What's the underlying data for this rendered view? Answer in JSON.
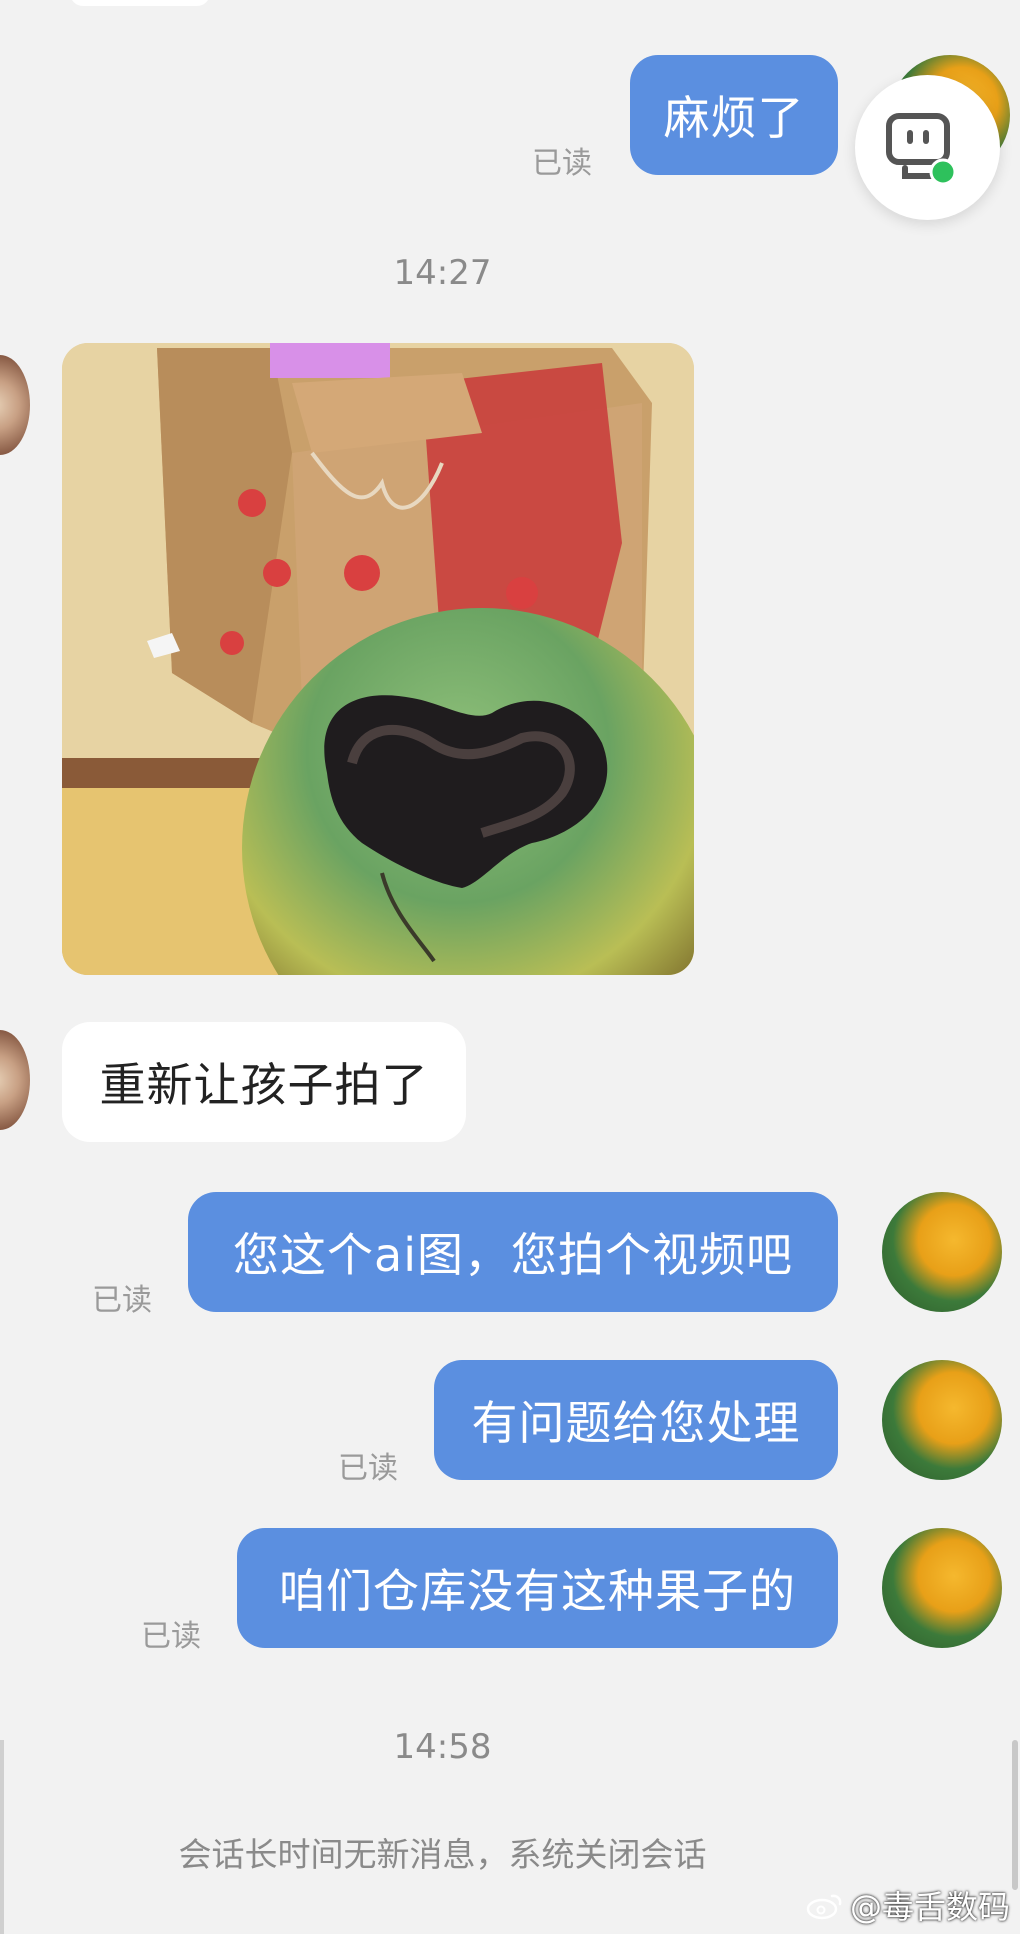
{
  "messages": {
    "m1": {
      "text": "麻烦了",
      "read": "已读"
    },
    "time1": "14:27",
    "m2": {
      "text": "重新让孩子拍了"
    },
    "m3": {
      "text": "您这个ai图，您拍个视频吧",
      "read": "已读"
    },
    "m4": {
      "text": "有问题给您处理",
      "read": "已读"
    },
    "m5": {
      "text": "咱们仓库没有这种果子的",
      "read": "已读"
    },
    "time2": "14:58",
    "system": "会话长时间无新消息，系统关闭会话"
  },
  "watermark": {
    "text": "@毒舌数码"
  },
  "colors": {
    "background": "#f2f2f2",
    "outgoing_bubble": "#5b8fe0",
    "incoming_bubble": "#ffffff",
    "online_dot": "#2ec15c"
  },
  "icons": {
    "assistant": "robot-chat-icon",
    "weibo": "weibo-icon"
  }
}
